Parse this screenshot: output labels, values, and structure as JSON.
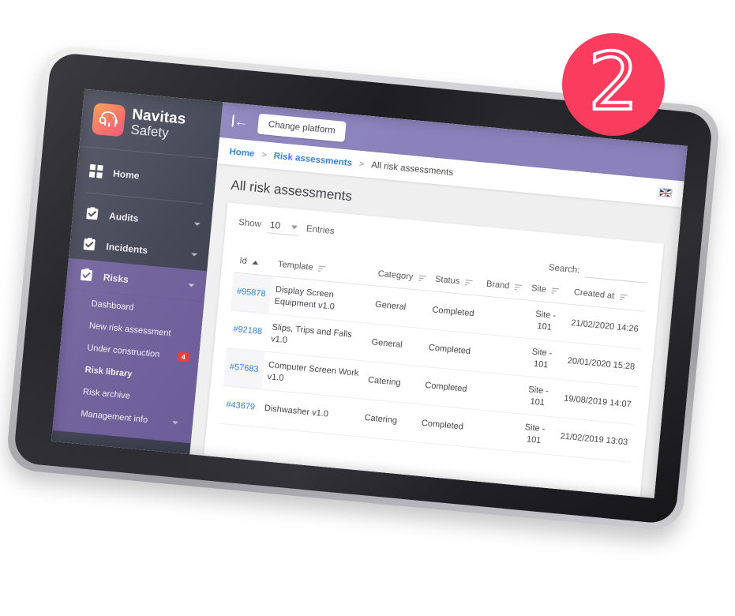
{
  "step_badge": {
    "number": "2",
    "color": "#fa3c5f"
  },
  "brand": {
    "line1": "Navitas",
    "line2": "Safety",
    "logo_icon": "elephant-logo-icon"
  },
  "sidebar": {
    "home": {
      "label": "Home",
      "icon": "grid-icon"
    },
    "items": [
      {
        "label": "Audits",
        "icon": "clipboard-check-icon",
        "active": false
      },
      {
        "label": "Incidents",
        "icon": "clipboard-check-icon",
        "active": false
      },
      {
        "label": "Risks",
        "icon": "clipboard-check-icon",
        "active": true
      }
    ],
    "sub_items": [
      {
        "label": "Dashboard",
        "badge": "",
        "strong": false
      },
      {
        "label": "New risk assessment",
        "badge": "",
        "strong": false
      },
      {
        "label": "Under construction",
        "badge": "4",
        "strong": false
      },
      {
        "label": "Risk library",
        "badge": "",
        "strong": true
      },
      {
        "label": "Risk archive",
        "badge": "",
        "strong": false
      },
      {
        "label": "Management info",
        "badge": "",
        "strong": false,
        "caret": true
      }
    ]
  },
  "topbar": {
    "collapse_icon": "collapse-left-icon",
    "change_platform_label": "Change platform",
    "background": "#8b82bc"
  },
  "breadcrumb": {
    "items": [
      {
        "label": "Home",
        "current": false
      },
      {
        "label": "Risk assessments",
        "current": false
      },
      {
        "label": "All risk assessments",
        "current": true
      }
    ],
    "separator": ">",
    "flag_icon": "uk-flag-icon"
  },
  "page": {
    "title": "All risk assessments"
  },
  "table_tools": {
    "show_label": "Show",
    "entries_value": "10",
    "entries_label": "Entries",
    "search_label": "Search:",
    "search_value": ""
  },
  "table": {
    "columns": [
      {
        "label": "Id",
        "sorted": true
      },
      {
        "label": "Template",
        "sorted": false
      },
      {
        "label": "Category",
        "sorted": false
      },
      {
        "label": "Status",
        "sorted": false
      },
      {
        "label": "Brand",
        "sorted": false
      },
      {
        "label": "Site",
        "sorted": false
      },
      {
        "label": "Created at",
        "sorted": false
      }
    ],
    "rows": [
      {
        "id": "#95878",
        "template": "Display Screen Equipment v1.0",
        "category": "General",
        "status": "Completed",
        "brand": "",
        "site": "Site - 101",
        "created_at": "21/02/2020 14:26"
      },
      {
        "id": "#92188",
        "template": "Slips, Trips and Falls v1.0",
        "category": "General",
        "status": "Completed",
        "brand": "",
        "site": "Site - 101",
        "created_at": "20/01/2020 15:28"
      },
      {
        "id": "#57683",
        "template": "Computer Screen Work v1.0",
        "category": "Catering",
        "status": "Completed",
        "brand": "",
        "site": "Site - 101",
        "created_at": "19/08/2019 14:07"
      },
      {
        "id": "#43679",
        "template": "Dishwasher v1.0",
        "category": "Catering",
        "status": "Completed",
        "brand": "",
        "site": "Site - 101",
        "created_at": "21/02/2019 13:03"
      }
    ]
  }
}
